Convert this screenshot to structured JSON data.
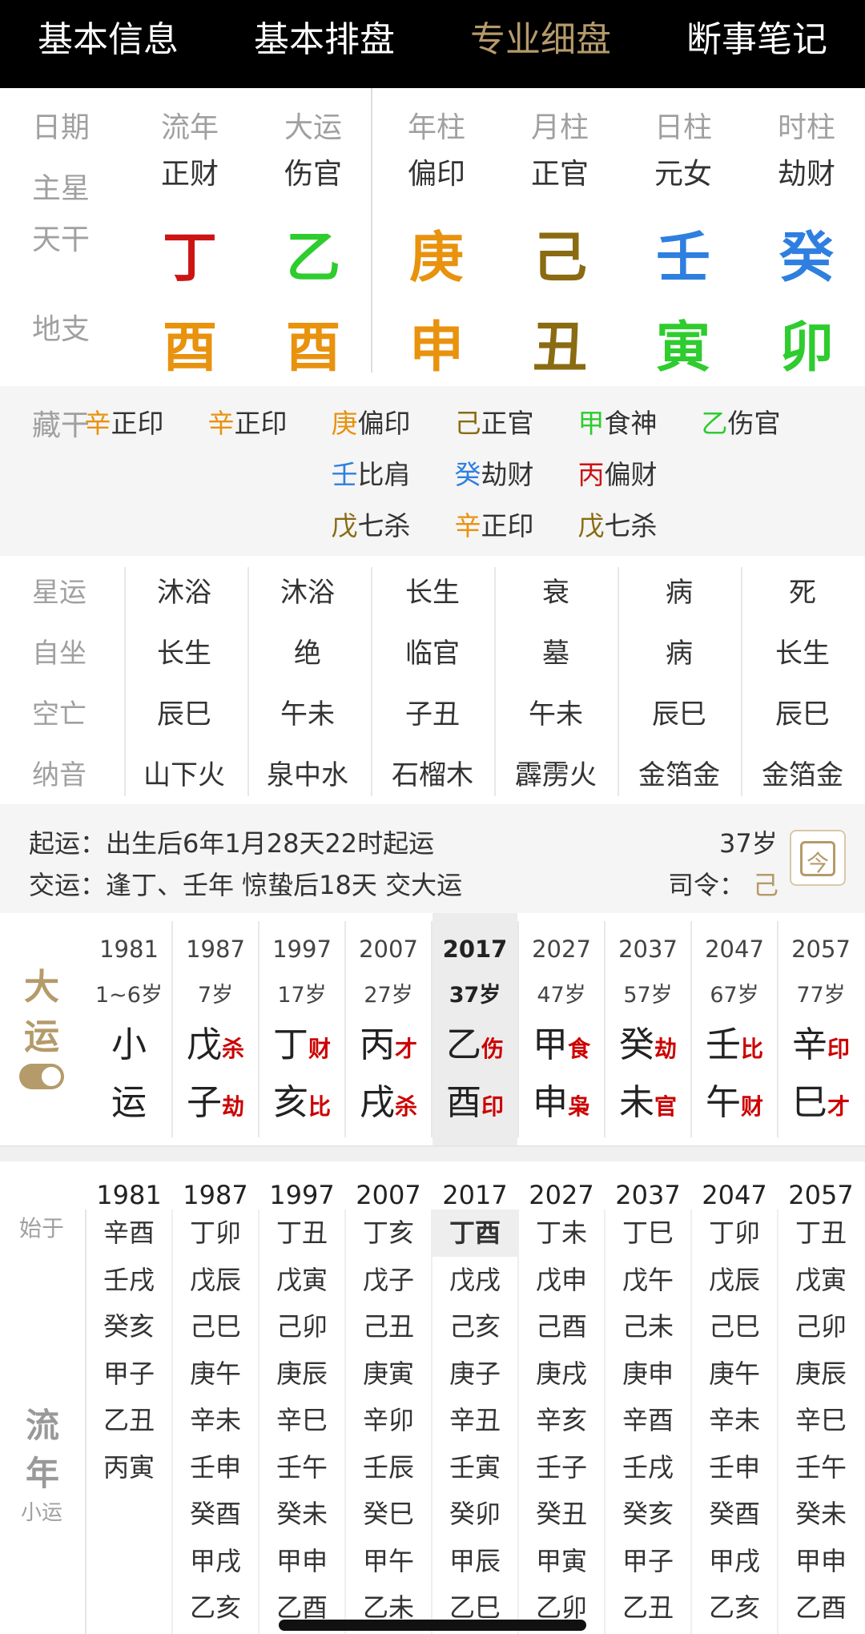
{
  "tabs": [
    "基本信息",
    "基本排盘",
    "专业细盘",
    "断事笔记"
  ],
  "header_labels": [
    "日期",
    "流年",
    "大运",
    "年柱",
    "月柱",
    "日柱",
    "时柱"
  ],
  "row_labels": {
    "zhuxing": "主星",
    "tiangan": "天干",
    "dizhi": "地支"
  },
  "zhuxing": [
    "正财",
    "伤官",
    "偏印",
    "正官",
    "元女",
    "劫财"
  ],
  "tiangan": [
    {
      "char": "丁",
      "color": "#cc1414"
    },
    {
      "char": "乙",
      "color": "#2ecc2e"
    },
    {
      "char": "庚",
      "color": "#e8920e"
    },
    {
      "char": "己",
      "color": "#8a6b12"
    },
    {
      "char": "壬",
      "color": "#2e7fe0"
    },
    {
      "char": "癸",
      "color": "#2e7fe0"
    }
  ],
  "dizhi": [
    {
      "char": "酉",
      "color": "#e8920e"
    },
    {
      "char": "酉",
      "color": "#e8920e"
    },
    {
      "char": "申",
      "color": "#e8920e"
    },
    {
      "char": "丑",
      "color": "#8a6b12"
    },
    {
      "char": "寅",
      "color": "#2ecc2e"
    },
    {
      "char": "卯",
      "color": "#2ecc2e"
    }
  ],
  "canggan_label": "藏干",
  "canggan": [
    [
      {
        "g": "辛",
        "c": "#e8920e",
        "s": "正印"
      }
    ],
    [
      {
        "g": "辛",
        "c": "#e8920e",
        "s": "正印"
      }
    ],
    [
      {
        "g": "庚",
        "c": "#e8920e",
        "s": "偏印"
      },
      {
        "g": "壬",
        "c": "#2e7fe0",
        "s": "比肩"
      },
      {
        "g": "戊",
        "c": "#8a6b12",
        "s": "七杀"
      }
    ],
    [
      {
        "g": "己",
        "c": "#8a6b12",
        "s": "正官"
      },
      {
        "g": "癸",
        "c": "#2e7fe0",
        "s": "劫财"
      },
      {
        "g": "辛",
        "c": "#e8920e",
        "s": "正印"
      }
    ],
    [
      {
        "g": "甲",
        "c": "#2ecc2e",
        "s": "食神"
      },
      {
        "g": "丙",
        "c": "#cc1414",
        "s": "偏财"
      },
      {
        "g": "戊",
        "c": "#8a6b12",
        "s": "七杀"
      }
    ],
    [
      {
        "g": "乙",
        "c": "#2ecc2e",
        "s": "伤官"
      }
    ]
  ],
  "extra_rows": [
    {
      "label": "星运",
      "values": [
        "沐浴",
        "沐浴",
        "长生",
        "衰",
        "病",
        "死"
      ]
    },
    {
      "label": "自坐",
      "values": [
        "长生",
        "绝",
        "临官",
        "墓",
        "病",
        "长生"
      ]
    },
    {
      "label": "空亡",
      "values": [
        "辰巳",
        "午未",
        "子丑",
        "午未",
        "辰巳",
        "辰巳"
      ]
    },
    {
      "label": "纳音",
      "values": [
        "山下火",
        "泉中水",
        "石榴木",
        "霹雳火",
        "金箔金",
        "金箔金"
      ]
    }
  ],
  "qiyun": {
    "line1": "起运：出生后6年1月28天22时起运",
    "line2": "交运：逢丁、壬年 惊蛰后18天 交大运",
    "age": "37岁",
    "siling_label": "司令：",
    "siling_value": "己",
    "calendar_icon_text": "今"
  },
  "dayun_label": [
    "大",
    "运"
  ],
  "dayun": [
    {
      "year": "1981",
      "age": "1~6岁",
      "g": "小",
      "gs": "",
      "z": "运",
      "zs": ""
    },
    {
      "year": "1987",
      "age": "7岁",
      "g": "戊",
      "gs": "杀",
      "z": "子",
      "zs": "劫"
    },
    {
      "year": "1997",
      "age": "17岁",
      "g": "丁",
      "gs": "财",
      "z": "亥",
      "zs": "比"
    },
    {
      "year": "2007",
      "age": "27岁",
      "g": "丙",
      "gs": "才",
      "z": "戌",
      "zs": "杀"
    },
    {
      "year": "2017",
      "age": "37岁",
      "g": "乙",
      "gs": "伤",
      "z": "酉",
      "zs": "印"
    },
    {
      "year": "2027",
      "age": "47岁",
      "g": "甲",
      "gs": "食",
      "z": "申",
      "zs": "枭"
    },
    {
      "year": "2037",
      "age": "57岁",
      "g": "癸",
      "gs": "劫",
      "z": "未",
      "zs": "官"
    },
    {
      "year": "2047",
      "age": "67岁",
      "g": "壬",
      "gs": "比",
      "z": "午",
      "zs": "财"
    },
    {
      "year": "2057",
      "age": "77岁",
      "g": "辛",
      "gs": "印",
      "z": "巳",
      "zs": "才"
    }
  ],
  "liunian_side": {
    "shiyu": "始于",
    "liunian": [
      "流",
      "年"
    ],
    "xiaoyun": "小运"
  },
  "liunian": [
    {
      "year": "1981",
      "items": [
        "辛酉",
        "壬戌",
        "癸亥",
        "甲子",
        "乙丑",
        "丙寅"
      ]
    },
    {
      "year": "1987",
      "items": [
        "丁卯",
        "戊辰",
        "己巳",
        "庚午",
        "辛未",
        "壬申",
        "癸酉",
        "甲戌",
        "乙亥"
      ]
    },
    {
      "year": "1997",
      "items": [
        "丁丑",
        "戊寅",
        "己卯",
        "庚辰",
        "辛巳",
        "壬午",
        "癸未",
        "甲申",
        "乙酉"
      ]
    },
    {
      "year": "2007",
      "items": [
        "丁亥",
        "戊子",
        "己丑",
        "庚寅",
        "辛卯",
        "壬辰",
        "癸巳",
        "甲午",
        "乙未"
      ]
    },
    {
      "year": "2017",
      "items": [
        "丁酉",
        "戊戌",
        "己亥",
        "庚子",
        "辛丑",
        "壬寅",
        "癸卯",
        "甲辰",
        "乙巳"
      ]
    },
    {
      "year": "2027",
      "items": [
        "丁未",
        "戊申",
        "己酉",
        "庚戌",
        "辛亥",
        "壬子",
        "癸丑",
        "甲寅",
        "乙卯"
      ]
    },
    {
      "year": "2037",
      "items": [
        "丁巳",
        "戊午",
        "己未",
        "庚申",
        "辛酉",
        "壬戌",
        "癸亥",
        "甲子",
        "乙丑"
      ]
    },
    {
      "year": "2047",
      "items": [
        "丁卯",
        "戊辰",
        "己巳",
        "庚午",
        "辛未",
        "壬申",
        "癸酉",
        "甲戌",
        "乙亥"
      ]
    },
    {
      "year": "2057",
      "items": [
        "丁丑",
        "戊寅",
        "己卯",
        "庚辰",
        "辛巳",
        "壬午",
        "癸未",
        "甲申",
        "乙酉"
      ]
    }
  ],
  "colors": {
    "accent": "#b59a6a",
    "shishen_red": "#cc0000"
  }
}
